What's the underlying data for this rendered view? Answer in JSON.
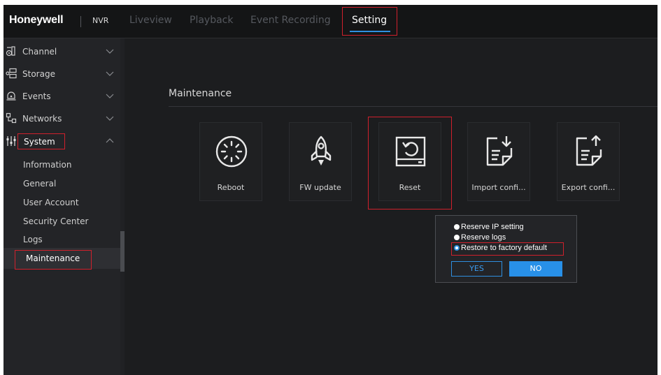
{
  "header": {
    "brand": "Honeywell",
    "product": "NVR",
    "tabs": [
      {
        "label": "Liveview"
      },
      {
        "label": "Playback"
      },
      {
        "label": "Event Recording"
      },
      {
        "label": "Setting",
        "active": true
      }
    ],
    "accent_color": "#2f8fe0",
    "highlight_color": "#d0202c"
  },
  "sidebar": {
    "sections": [
      {
        "label": "Channel",
        "icon": "channel-icon",
        "expanded": false
      },
      {
        "label": "Storage",
        "icon": "storage-icon",
        "expanded": false
      },
      {
        "label": "Events",
        "icon": "events-icon",
        "expanded": false
      },
      {
        "label": "Networks",
        "icon": "networks-icon",
        "expanded": false
      },
      {
        "label": "System",
        "icon": "system-icon",
        "expanded": true
      }
    ],
    "sub_items": [
      {
        "label": "Information"
      },
      {
        "label": "General"
      },
      {
        "label": "User Account"
      },
      {
        "label": "Security Center"
      },
      {
        "label": "Logs"
      },
      {
        "label": "Maintenance",
        "active": true
      }
    ]
  },
  "main": {
    "section_title": "Maintenance",
    "tiles": [
      {
        "label": "Reboot",
        "icon": "reboot-icon"
      },
      {
        "label": "FW update",
        "icon": "rocket-icon"
      },
      {
        "label": "Reset",
        "icon": "reset-icon"
      },
      {
        "label": "Import confi...",
        "icon": "import-config-icon"
      },
      {
        "label": "Export confi...",
        "icon": "export-config-icon"
      }
    ]
  },
  "reset_dialog": {
    "options": [
      {
        "label": "Reserve IP setting",
        "selected": false
      },
      {
        "label": "Reserve logs",
        "selected": false
      },
      {
        "label": "Restore to factory default",
        "selected": true
      }
    ],
    "yes_label": "YES",
    "no_label": "NO"
  }
}
